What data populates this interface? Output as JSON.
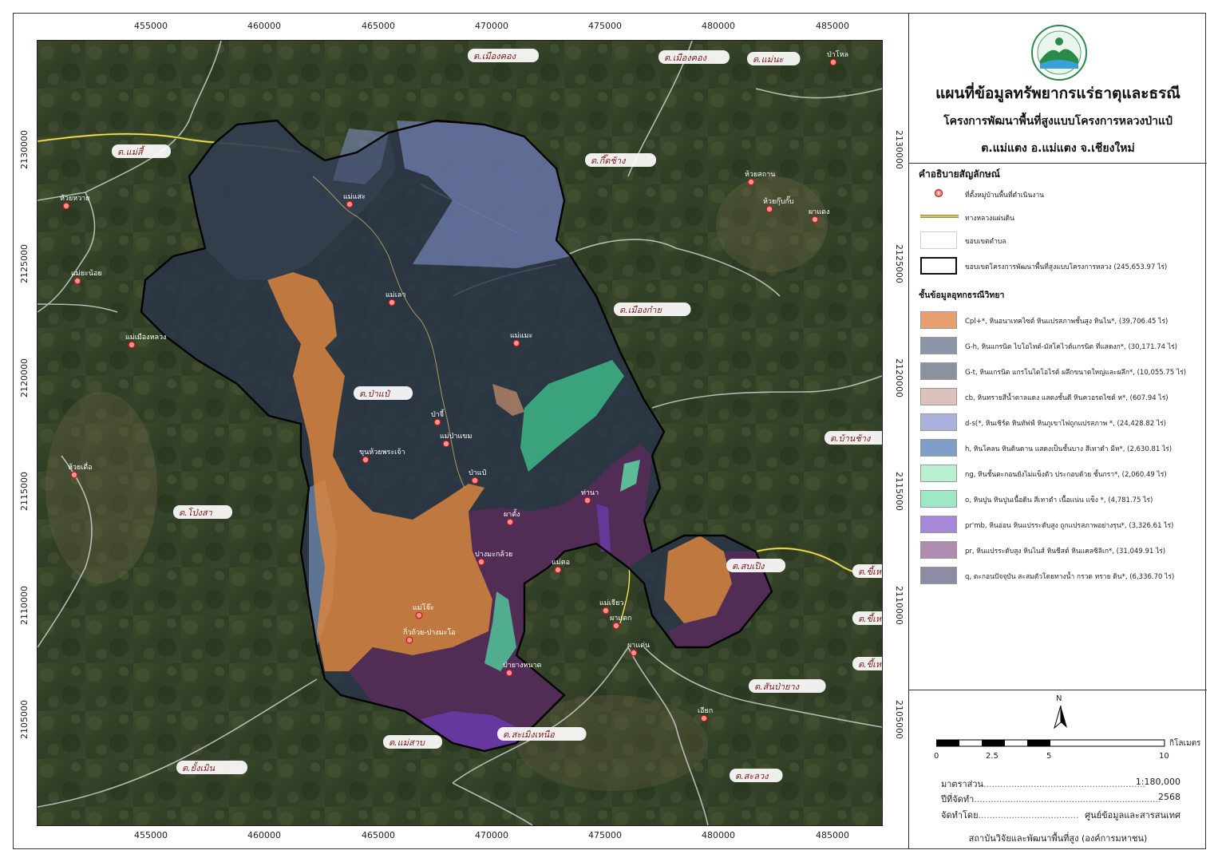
{
  "titles": {
    "main": "แผนที่ข้อมูลทรัพยากรแร่ธาตุและธรณี",
    "sub": "โครงการพัฒนาพื้นที่สูงแบบโครงการหลวงป่าแป๋",
    "area": "ต.แม่แตง อ.แม่แตง จ.เชียงใหม่"
  },
  "grid": {
    "x_labels": [
      "455000",
      "460000",
      "465000",
      "470000",
      "475000",
      "480000",
      "485000"
    ],
    "y_labels": [
      "2130000",
      "2125000",
      "2120000",
      "2115000",
      "2110000",
      "2105000"
    ]
  },
  "legend": {
    "heading": "คำอธิบายสัญลักษณ์",
    "symbols": [
      {
        "label": "ที่ตั้งหมู่บ้านพื้นที่ดำเนินงาน"
      },
      {
        "label": "ทางหลวงแผ่นดิน"
      },
      {
        "label": "ขอบเขตตำบล"
      },
      {
        "label": "ขอบเขตโครงการพัฒนาพื้นที่สูงแบบโครงการหลวง (245,653.97 ไร่)"
      }
    ],
    "geo_heading": "ชั้นข้อมูลอุทกธรณีวิทยา",
    "geo_units": [
      {
        "label": "Cpl+*,  หินอนาเทคไซต์ หินแปรสภาพชั้นสูง หินไน*, (39,706.45 ไร่)",
        "color": "#e8a070"
      },
      {
        "label": "G-h,  หินแกรนิต ไบโอไทต์-มัสโคไวต์แกรนิต ที่แสดงก*, (30,171.74 ไร่)",
        "color": "#8a95a8"
      },
      {
        "label": "G-t,  หินแกรนิต แกรโนไดโอไรต์ ผลึกขนาดใหญ่และผลึก*, (10,055.75 ไร่)",
        "color": "#8c91a0"
      },
      {
        "label": "cb, หินทรายสีน้ำตาลแดง แสดงชั้นดี หินควอรตไซต์ ห*, (607.94 ไร่)",
        "color": "#dcc0bc"
      },
      {
        "label": "d-s(*,  หินเชิร์ต หินทัฟฟ์ หินภูเขาไฟถูกแปรสภาพ *, (24,428.82 ไร่)",
        "color": "#a8b0dc"
      },
      {
        "label": "h,  หินโคลน หินดินดาน แสดงเป็นชั้นบาง สีเทาดำ มีห*, (2,630.81 ไร่)",
        "color": "#7e9ec8"
      },
      {
        "label": "ng,  หินชั้นตะกอนยังไม่แข็งตัว ประกอบด้วย ชั้นกรา*, (2,060.49 ไร่)",
        "color": "#b8f0d0"
      },
      {
        "label": "o,  หินปูน หินปูนเนื้อดิน สีเทาดำ เนื้อแน่น แข็ง *, (4,781.75 ไร่)",
        "color": "#9ee8c8"
      },
      {
        "label": "pr'mb,  หินอ่อน หินแปรระดับสูง ถูกแปรสภาพอย่างรุน*, (3,326.61 ไร่)",
        "color": "#a888d8"
      },
      {
        "label": "pr,  หินแปรระดับสูง หินไนส์ หินชีสต์ หินแคลซิลิเก*, (31,049.91 ไร่)",
        "color": "#b08cb0"
      },
      {
        "label": "q,  ตะกอนปัจจุบัน สะสมตัวโดยทางน้ำ กรวด  ทราย ดิน*, (6,336.70 ไร่)",
        "color": "#8c8ca4"
      }
    ]
  },
  "scale": {
    "north": "N",
    "ticks": [
      "0",
      "2.5",
      "5",
      "10"
    ],
    "unit": "กิโลเมตร"
  },
  "info": {
    "scale_label": "มาตราส่วน",
    "scale_value": "1:180,000",
    "year_label": "ปีที่จัดทำ",
    "year_value": "2568",
    "by_label": "จัดทำโดย",
    "by_value": "ศูนย์ข้อมูลและสารสนเทศ",
    "institute": "สถาบันวิจัยและพัฒนาพื้นที่สูง (องค์การมหาชน)"
  },
  "tambons": [
    {
      "name": "ต.เมืองคอง"
    },
    {
      "name": "ต.เมืองคอง"
    },
    {
      "name": "ต.แม่นะ"
    },
    {
      "name": "ต.แม่สี้"
    },
    {
      "name": "ต.กึ๊ดช้าง"
    },
    {
      "name": "ต.เมืองก๋าย"
    },
    {
      "name": "ต.ป่าแป๋"
    },
    {
      "name": "ต.บ้านช้าง"
    },
    {
      "name": "ต.โป่งสา"
    },
    {
      "name": "ต.สบเปิง"
    },
    {
      "name": "ต.ขี้เหล็ก"
    },
    {
      "name": "ต.ขี้เหล็ก"
    },
    {
      "name": "ต.ขี้เหล็ก"
    },
    {
      "name": "ต.สันป่ายาง"
    },
    {
      "name": "ต.สะเมิงเหนือ"
    },
    {
      "name": "ต.แม่สาบ"
    },
    {
      "name": "ต.ยั้งเมิน"
    },
    {
      "name": "ต.สะลวง"
    }
  ],
  "villages": [
    {
      "name": "ป่าโหล"
    },
    {
      "name": "ห้วยสถาน"
    },
    {
      "name": "ห้วยกุ๊บกั๊บ"
    },
    {
      "name": "ผาแดง"
    },
    {
      "name": "ห้วยหวาย"
    },
    {
      "name": "แม่ยะน้อย"
    },
    {
      "name": "แม่เมืองหลวง"
    },
    {
      "name": "ห้วยเดื่อ"
    },
    {
      "name": "แม่แสะ"
    },
    {
      "name": "แม่เลา"
    },
    {
      "name": "แม่แมะ"
    },
    {
      "name": "ป่าจี้"
    },
    {
      "name": "แม่ป่าแขม"
    },
    {
      "name": "ขุนห้วยพระเจ้า"
    },
    {
      "name": "ป่าแป๋"
    },
    {
      "name": "ท่านา"
    },
    {
      "name": "ผาตั้ง"
    },
    {
      "name": "ปางมะกล้วย"
    },
    {
      "name": "แม่ตอ"
    },
    {
      "name": "แม่โจ๊ะ"
    },
    {
      "name": "แม่เจียว"
    },
    {
      "name": "ผาแตก"
    },
    {
      "name": "กิ่วถ้วย-ปางมะโอ"
    },
    {
      "name": "ผาแด่น"
    },
    {
      "name": "ป่ายางหนาด"
    },
    {
      "name": "เอียก"
    }
  ]
}
